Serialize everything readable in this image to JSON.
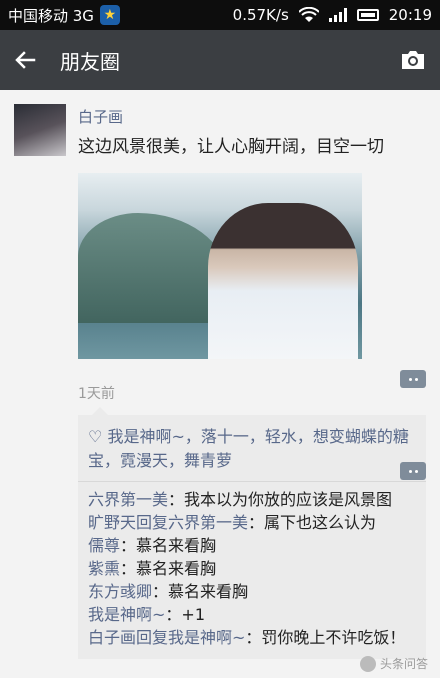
{
  "status_bar": {
    "carrier": "中国移动 3G",
    "speed": "0.57K/s",
    "time": "20:19"
  },
  "app_bar": {
    "title": "朋友圈"
  },
  "post": {
    "author": "白子画",
    "text": "这边风景很美，让人心胸开阔，目空一切",
    "time": "1天前"
  },
  "likes": "我是神啊~，落十一，轻水，想变蝴蝶的糖宝，霓漫天，舞青萝",
  "comments": [
    {
      "name": "六界第一美",
      "text": "：我本以为你放的应该是风景图"
    },
    {
      "name": "旷野天回复六界第一美",
      "text": "：属下也这么认为"
    },
    {
      "name": "儒尊",
      "text": "：慕名来看胸"
    },
    {
      "name": "紫熏",
      "text": "：慕名来看胸"
    },
    {
      "name": "东方彧卿",
      "text": "：慕名来看胸"
    },
    {
      "name": "我是神啊~",
      "text": "：+1"
    },
    {
      "name": "白子画回复我是神啊~",
      "text": "：罚你晚上不许吃饭！"
    }
  ],
  "watermark": "头条问答",
  "icons": [
    "star-icon",
    "wifi-icon",
    "signal-icon",
    "battery-icon",
    "back-arrow-icon",
    "camera-icon",
    "comment-icon",
    "heart-icon"
  ]
}
